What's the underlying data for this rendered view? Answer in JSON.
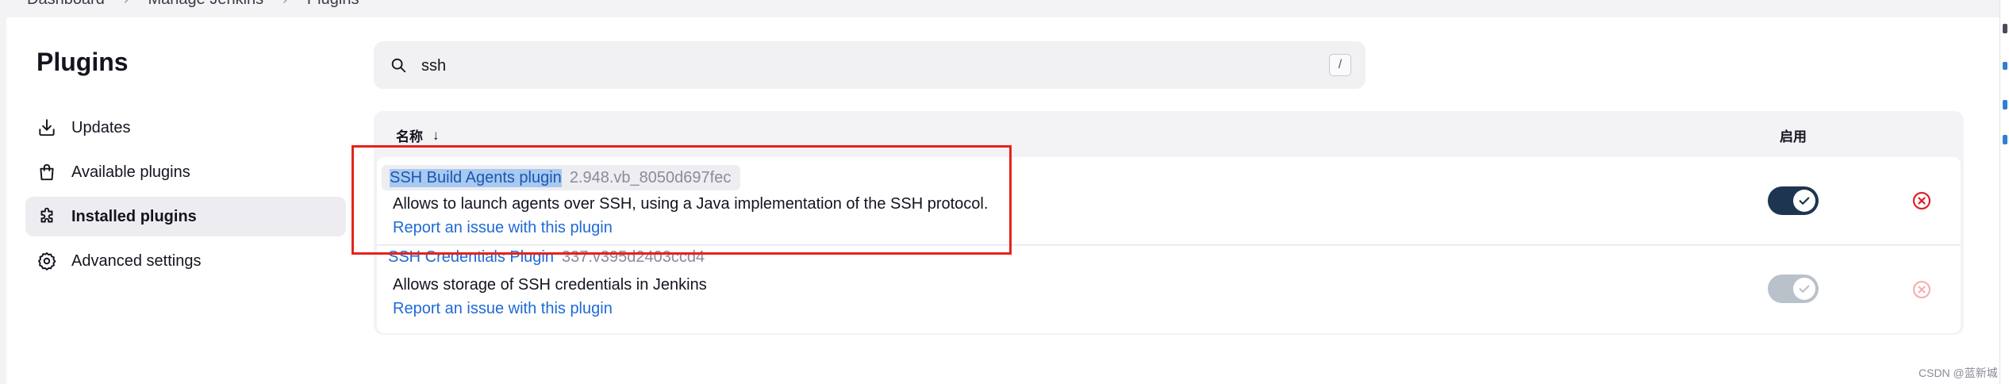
{
  "breadcrumb": [
    "Dashboard",
    "Manage Jenkins",
    "Plugins"
  ],
  "page": {
    "title": "Plugins"
  },
  "sidebar": {
    "items": [
      {
        "label": "Updates",
        "icon": "download-icon",
        "active": false
      },
      {
        "label": "Available plugins",
        "icon": "shopping-bag-icon",
        "active": false
      },
      {
        "label": "Installed plugins",
        "icon": "puzzle-icon",
        "active": true
      },
      {
        "label": "Advanced settings",
        "icon": "gear-icon",
        "active": false
      }
    ]
  },
  "search": {
    "value": "ssh",
    "shortcut": "/"
  },
  "table": {
    "columns": {
      "name": "名称",
      "sort_indicator": "↓",
      "enabled": "启用"
    },
    "rows": [
      {
        "name": "SSH Build Agents plugin",
        "version": "2.948.vb_8050d697fec",
        "description": "Allows to launch agents over SSH, using a Java implementation of the SSH protocol.",
        "report": "Report an issue with this plugin",
        "enabled": true,
        "uninstall_allowed": true
      },
      {
        "name": "SSH Credentials Plugin",
        "version": "337.v395d2403ccd4",
        "description": "Allows storage of SSH credentials in Jenkins",
        "report": "Report an issue with this plugin",
        "enabled": true,
        "uninstall_allowed": false
      }
    ]
  },
  "watermark": "CSDN @蓝新城",
  "colors": {
    "accent_link": "#1e6ad6",
    "toggle_on": "#1e3552",
    "toggle_disabled": "#b9c2cb",
    "uninstall": "#e0202b",
    "annotation_box": "#e5231b"
  }
}
